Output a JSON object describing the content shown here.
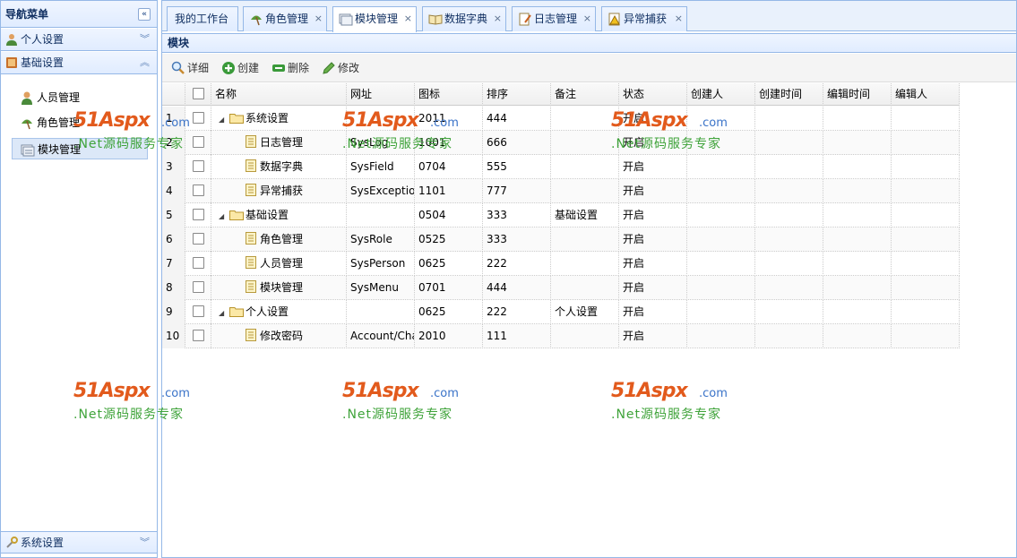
{
  "sidebar": {
    "title": "导航菜单",
    "collapse_icon": "double-chevron-left-icon",
    "groups": [
      {
        "label": "个人设置",
        "icon": "user-icon",
        "state": "collapsed"
      },
      {
        "label": "基础设置",
        "icon": "book-icon",
        "state": "expanded"
      },
      {
        "label": "系统设置",
        "icon": "wrench-icon",
        "state": "collapsed"
      }
    ],
    "items": [
      {
        "label": "人员管理",
        "icon": "person-icon"
      },
      {
        "label": "角色管理",
        "icon": "umbrella-icon"
      },
      {
        "label": "模块管理",
        "icon": "window-icon",
        "selected": true
      }
    ]
  },
  "tabs": [
    {
      "label": "我的工作台",
      "closable": false
    },
    {
      "label": "角色管理",
      "closable": true
    },
    {
      "label": "模块管理",
      "closable": true,
      "active": true
    },
    {
      "label": "数据字典",
      "closable": true
    },
    {
      "label": "日志管理",
      "closable": true
    },
    {
      "label": "异常捕获",
      "closable": true
    }
  ],
  "tab_close_glyph": "×",
  "panel": {
    "title": "模块"
  },
  "toolbar": {
    "detail": "详细",
    "create": "创建",
    "delete": "删除",
    "edit": "修改"
  },
  "grid": {
    "columns": [
      "名称",
      "网址",
      "图标",
      "排序",
      "备注",
      "状态",
      "创建人",
      "创建时间",
      "编辑时间",
      "编辑人"
    ],
    "rows": [
      {
        "num": "1",
        "name": "系统设置",
        "folder": true,
        "url": "",
        "icon": "2011",
        "sort": "444",
        "note": "",
        "status": "开启"
      },
      {
        "num": "2",
        "name": "日志管理",
        "folder": false,
        "url": "SysLog",
        "icon": "1001",
        "sort": "666",
        "note": "",
        "status": "开启"
      },
      {
        "num": "3",
        "name": "数据字典",
        "folder": false,
        "url": "SysField",
        "icon": "0704",
        "sort": "555",
        "note": "",
        "status": "开启"
      },
      {
        "num": "4",
        "name": "异常捕获",
        "folder": false,
        "url": "SysException",
        "icon": "1101",
        "sort": "777",
        "note": "",
        "status": "开启"
      },
      {
        "num": "5",
        "name": "基础设置",
        "folder": true,
        "url": "",
        "icon": "0504",
        "sort": "333",
        "note": "基础设置",
        "status": "开启"
      },
      {
        "num": "6",
        "name": "角色管理",
        "folder": false,
        "url": "SysRole",
        "icon": "0525",
        "sort": "333",
        "note": "",
        "status": "开启"
      },
      {
        "num": "7",
        "name": "人员管理",
        "folder": false,
        "url": "SysPerson",
        "icon": "0625",
        "sort": "222",
        "note": "",
        "status": "开启"
      },
      {
        "num": "8",
        "name": "模块管理",
        "folder": false,
        "url": "SysMenu",
        "icon": "0701",
        "sort": "444",
        "note": "",
        "status": "开启"
      },
      {
        "num": "9",
        "name": "个人设置",
        "folder": true,
        "url": "",
        "icon": "0625",
        "sort": "222",
        "note": "个人设置",
        "status": "开启"
      },
      {
        "num": "10",
        "name": "修改密码",
        "folder": false,
        "url": "Account/Cha",
        "icon": "2010",
        "sort": "111",
        "note": "",
        "status": "开启"
      }
    ]
  },
  "watermark": {
    "brand": "51Aspx",
    "domain": ".com",
    "slogan": ".Net源码服务专家"
  }
}
